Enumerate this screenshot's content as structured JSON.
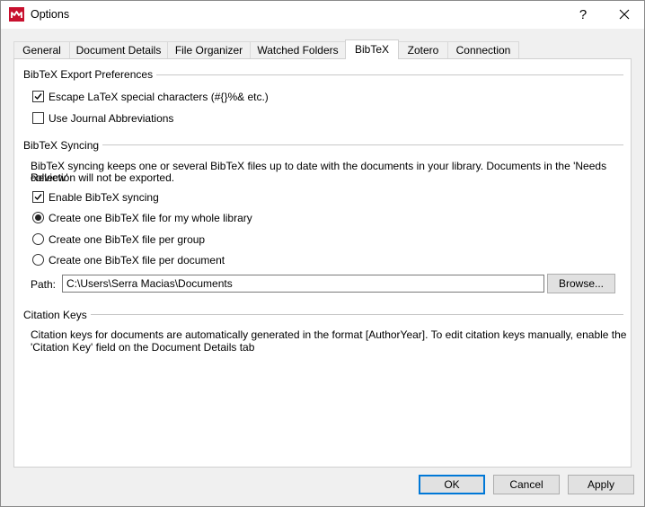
{
  "window": {
    "title": "Options"
  },
  "titlebar": {
    "help_label": "?"
  },
  "tabs": [
    {
      "label": "General"
    },
    {
      "label": "Document Details"
    },
    {
      "label": "File Organizer"
    },
    {
      "label": "Watched Folders"
    },
    {
      "label": "BibTeX",
      "active": true
    },
    {
      "label": "Zotero"
    },
    {
      "label": "Connection"
    }
  ],
  "export_prefs": {
    "title": "BibTeX Export Preferences",
    "escape_latex": {
      "label": "Escape LaTeX special characters (#{}%& etc.)",
      "checked": true
    },
    "journal_abbrev": {
      "label": "Use Journal Abbreviations",
      "checked": false
    }
  },
  "syncing": {
    "title": "BibTeX Syncing",
    "description_line1": "BibTeX syncing keeps one or several BibTeX files up to date with the documents in your library. Documents in the 'Needs Review'",
    "description_line2": "collection will not be exported.",
    "enable": {
      "label": "Enable BibTeX syncing",
      "checked": true
    },
    "options": [
      {
        "label": "Create one BibTeX file for my whole library",
        "selected": true
      },
      {
        "label": "Create one BibTeX file per group",
        "selected": false
      },
      {
        "label": "Create one BibTeX file per document",
        "selected": false
      }
    ],
    "path_label": "Path:",
    "path_value": "C:\\Users\\Serra Macias\\Documents",
    "browse_label": "Browse..."
  },
  "citation": {
    "title": "Citation Keys",
    "description_line1": "Citation keys for documents are automatically generated in the format [AuthorYear]. To edit citation keys manually, enable the",
    "description_line2": "'Citation Key' field on the Document Details tab"
  },
  "footer": {
    "ok_label": "OK",
    "cancel_label": "Cancel",
    "apply_label": "Apply"
  },
  "colors": {
    "accent": "#0078d7",
    "brand": "#c8102e"
  }
}
